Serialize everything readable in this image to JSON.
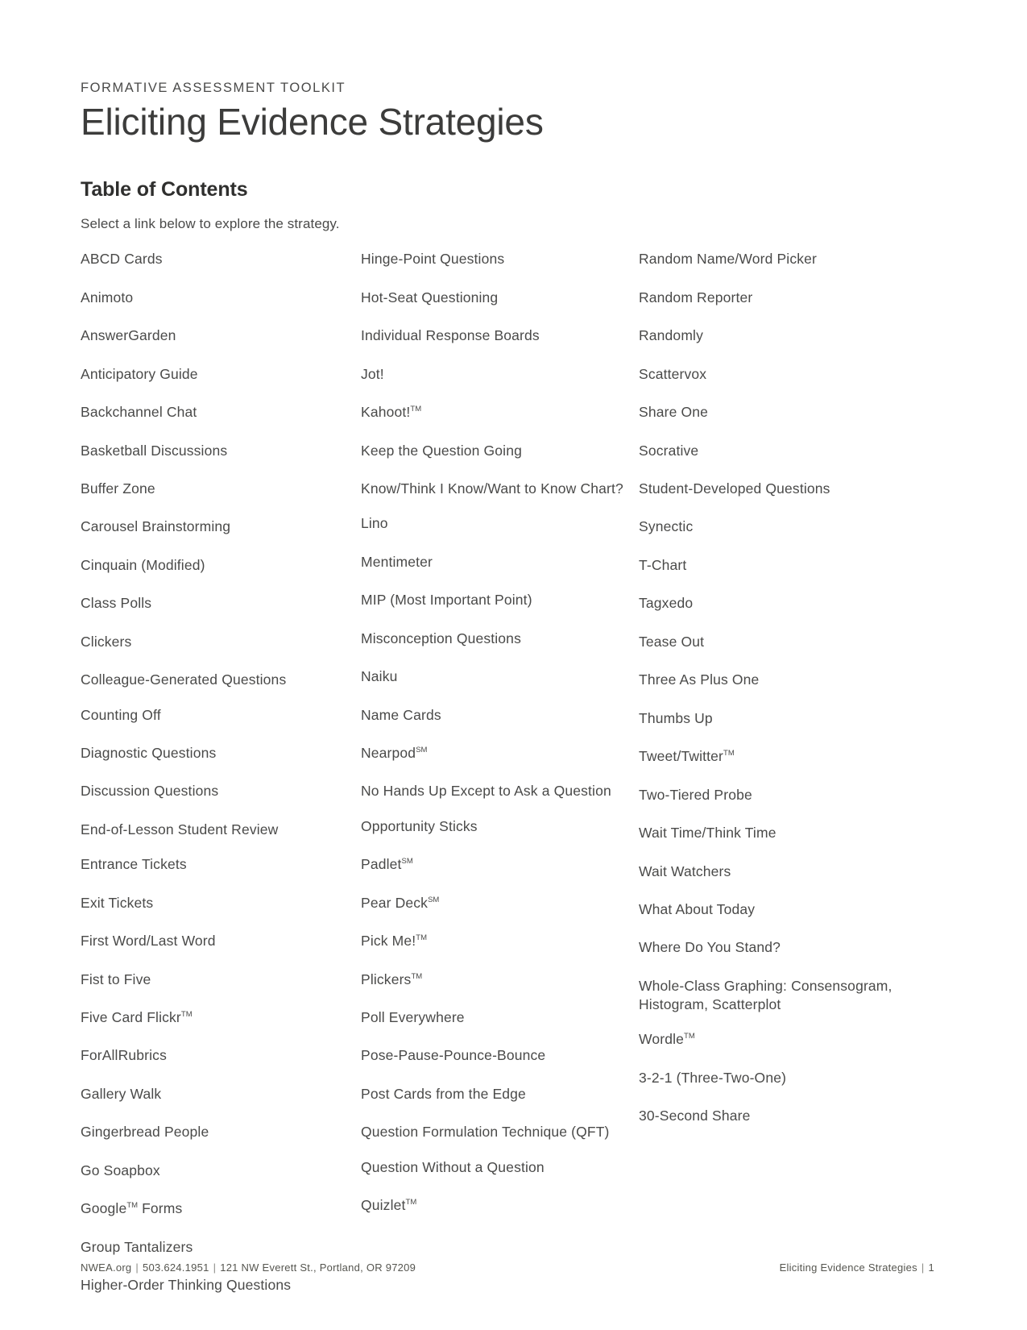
{
  "header": {
    "eyebrow": "FORMATIVE ASSESSMENT TOOLKIT",
    "title": "Eliciting Evidence Strategies"
  },
  "toc": {
    "heading": "Table of Contents",
    "instruction": "Select a link below to explore the strategy.",
    "column1": [
      "ABCD Cards",
      "Animoto",
      "AnswerGarden",
      "Anticipatory Guide",
      "Backchannel Chat",
      "Basketball Discussions",
      "Buffer Zone",
      "Carousel Brainstorming",
      "Cinquain (Modified)",
      "Class Polls",
      "Clickers",
      "Colleague-Generated Questions",
      "Counting Off",
      "Diagnostic Questions",
      "Discussion Questions",
      "End-of-Lesson Student Review",
      "Entrance Tickets",
      "Exit Tickets",
      "First Word/Last Word",
      "Fist to Five",
      "Five Card Flickr™",
      "ForAllRubrics",
      "Gallery Walk",
      "Gingerbread People",
      "Go Soapbox",
      "Google™ Forms",
      "Group Tantalizers",
      "Higher-Order Thinking Questions"
    ],
    "column2": [
      "Hinge-Point Questions",
      "Hot-Seat Questioning",
      "Individual Response Boards",
      "Jot!",
      "Kahoot!™",
      "Keep the Question Going",
      "Know/Think I Know/Want to Know Chart?",
      "Lino",
      "Mentimeter",
      "MIP (Most Important Point)",
      "Misconception Questions",
      "Naiku",
      "Name Cards",
      "Nearpod℠",
      "No Hands Up Except to Ask a Question",
      "Opportunity Sticks",
      "Padlet℠",
      "Pear Deck℠",
      "Pick Me!™",
      "Plickers™",
      "Poll Everywhere",
      "Pose-Pause-Pounce-Bounce",
      "Post Cards from the Edge",
      "Question Formulation Technique (QFT)",
      "Question Without a Question",
      "Quizlet™"
    ],
    "column3": [
      "Random Name/Word Picker",
      "Random Reporter",
      "Randomly",
      "Scattervox",
      "Share One",
      "Socrative",
      "Student-Developed Questions",
      "Synectic",
      "T-Chart",
      "Tagxedo",
      "Tease Out",
      "Three As Plus One",
      "Thumbs Up",
      "Tweet/Twitter™",
      "Two-Tiered Probe",
      "Wait Time/Think Time",
      "Wait Watchers",
      "What About Today",
      "Where Do You Stand?",
      "Whole-Class Graphing: Consensogram, Histogram, Scatterplot",
      "Wordle™",
      "3-2-1 (Three-Two-One)",
      "30-Second Share"
    ]
  },
  "footer": {
    "website": "NWEA.org",
    "phone": "503.624.1951",
    "address": "121 NW Everett St., Portland, OR 97209",
    "document_name": "Eliciting Evidence Strategies",
    "page_number": "1",
    "separator": "|"
  },
  "colors": {
    "text": "#4a4a49",
    "heading": "#3c3c3b",
    "background": "#ffffff"
  }
}
